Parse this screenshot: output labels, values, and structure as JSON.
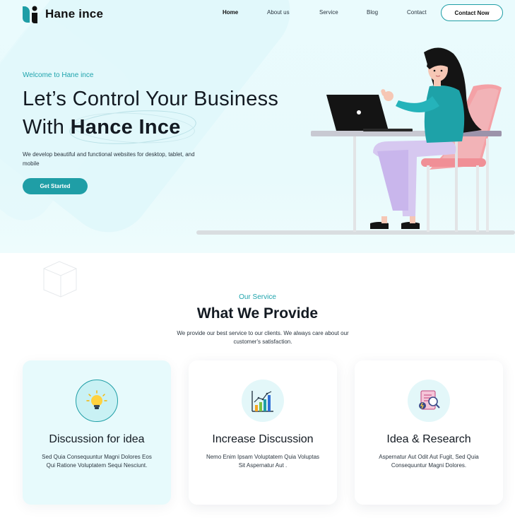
{
  "brand": {
    "name": "Hane ince"
  },
  "nav": {
    "links": [
      "Home",
      "About us",
      "Service",
      "Blog",
      "Contact"
    ],
    "active": "Home",
    "cta_label": "Contact Now"
  },
  "hero": {
    "welcome": "Welcome to Hane ince",
    "headline_line1": "Let’s Control Your Business",
    "headline_line2_prefix": "With",
    "headline_line2_strong": "Hance Ince",
    "description": "We develop beautiful and functional websites for desktop, tablet, and mobile",
    "cta_label": "Get Started"
  },
  "services": {
    "eyebrow": "Our Service",
    "title": "What We Provide",
    "description": "We provide our best service to our clients. We always care about our customer's satisfaction.",
    "cards": [
      {
        "title": "Discussion for idea",
        "text": "Sed Quia Consequuntur Magni Dolores Eos Qui Ratione Voluptatem Sequi Nesciunt.",
        "icon": "lightbulb-icon"
      },
      {
        "title": "Increase Discussion",
        "text": "Nemo Enim Ipsam Voluptatem Quia Voluptas Sit Aspernatur Aut .",
        "icon": "bar-chart-icon"
      },
      {
        "title": "Idea & Research",
        "text": "Aspernatur Aut Odit Aut Fugit, Sed Quia Consequuntur Magni Dolores.",
        "icon": "research-document-icon"
      }
    ]
  },
  "colors": {
    "accent": "#1f9ea6",
    "hero_background": "#e8fafc",
    "highlight_card": "#e7fafc",
    "text_dark": "#131a22"
  }
}
